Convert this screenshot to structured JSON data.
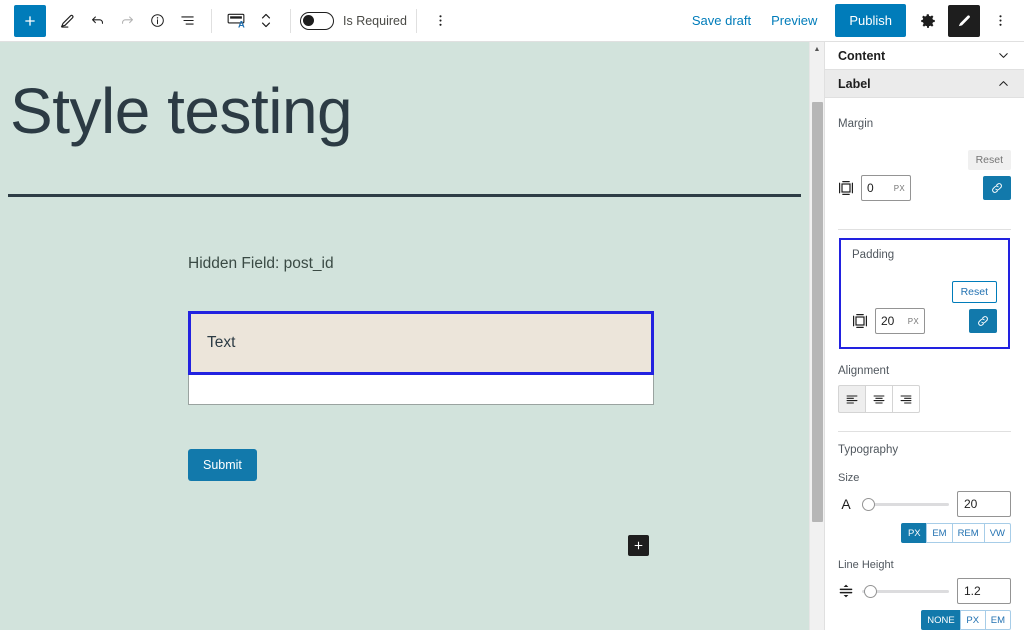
{
  "toolbar": {
    "add_block_label": "+",
    "tools": [
      {
        "name": "add-block-button",
        "icon": "plus-icon"
      },
      {
        "name": "tools-edit-button",
        "icon": "pencil-icon"
      },
      {
        "name": "undo-button",
        "icon": "undo-arrow-icon"
      },
      {
        "name": "redo-button",
        "icon": "redo-arrow-icon"
      },
      {
        "name": "details-button",
        "icon": "info-circle-icon"
      },
      {
        "name": "list-view-button",
        "icon": "list-view-icon"
      },
      {
        "name": "block-type-button",
        "icon": "block-text-icon"
      },
      {
        "name": "move-block-button",
        "icon": "up-down-chevron-icon"
      },
      {
        "name": "options-button",
        "icon": "three-dots-vertical-icon"
      }
    ],
    "is_required_label": "Is Required",
    "is_required_on": false,
    "save_draft_label": "Save draft",
    "preview_label": "Preview",
    "publish_label": "Publish",
    "settings_icon": "gear-icon",
    "styles_icon": "paintbrush-icon",
    "more_icon": "three-dots-vertical-icon"
  },
  "canvas": {
    "title": "Style testing",
    "hidden_field_note": "Hidden Field: post_id",
    "field_label": "Text",
    "field_value": "",
    "submit_label": "Submit",
    "appender_icon": "plus-icon",
    "background_color": "#d2e3dc",
    "label_background_color": "#ece5da",
    "selection_color": "#2222e0",
    "submit_color": "#1279ab"
  },
  "sidebar": {
    "panels": [
      {
        "label": "Content",
        "expanded": false,
        "chevron": "chevron-down-icon"
      },
      {
        "label": "Label",
        "expanded": true,
        "chevron": "chevron-up-icon"
      }
    ],
    "margin": {
      "title": "Margin",
      "reset_label": "Reset",
      "value": "0",
      "unit": "PX",
      "sides_icon": "box-sides-icon",
      "link_icon": "link-sides-icon",
      "focused": false
    },
    "padding": {
      "title": "Padding",
      "reset_label": "Reset",
      "value": "20",
      "unit": "PX",
      "sides_icon": "box-sides-icon",
      "link_icon": "link-sides-icon",
      "focused": true
    },
    "alignment": {
      "title": "Alignment",
      "options": [
        {
          "name": "align-left",
          "icon": "align-left-icon",
          "selected": true
        },
        {
          "name": "align-center",
          "icon": "align-center-icon",
          "selected": false
        },
        {
          "name": "align-right",
          "icon": "align-right-icon",
          "selected": false
        }
      ]
    },
    "typography": {
      "title": "Typography",
      "size": {
        "label": "Size",
        "glyph": "A",
        "value": "20",
        "slider_percent": 2,
        "units": [
          "PX",
          "EM",
          "REM",
          "VW"
        ],
        "selected_unit": "PX"
      },
      "line_height": {
        "label": "Line Height",
        "icon": "line-height-icon",
        "value": "1.2",
        "slider_percent": 2,
        "units": [
          "NONE",
          "PX",
          "EM"
        ],
        "selected_unit": "NONE"
      }
    }
  },
  "scrollbar": {
    "up_arrow": "scroll-up-arrow",
    "thumb": "scroll-thumb"
  }
}
